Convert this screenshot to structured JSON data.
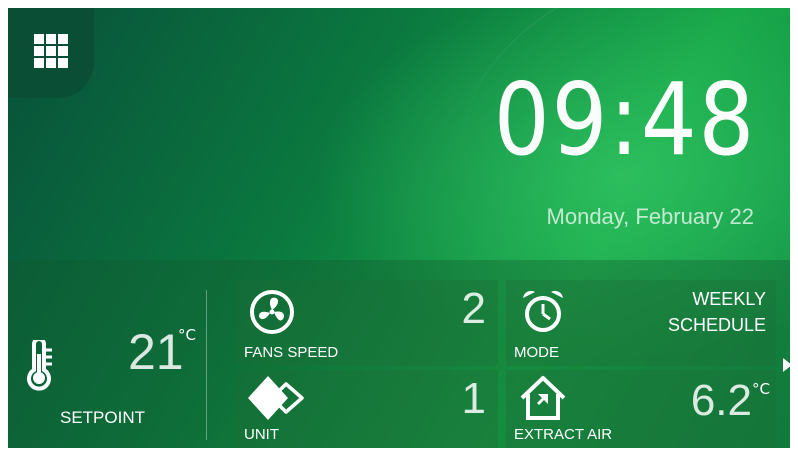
{
  "menu": {
    "icon": "grid-menu-icon"
  },
  "clock": {
    "time": "09:48",
    "date": "Monday, February 22"
  },
  "setpoint": {
    "value": "21",
    "unit": "°C",
    "label": "SETPOINT",
    "icon": "thermometer-icon"
  },
  "tiles": {
    "fans_speed": {
      "label": "FANS SPEED",
      "value": "2",
      "icon": "fan-icon"
    },
    "mode": {
      "label": "MODE",
      "value": "WEEKLY SCHEDULE",
      "value_line1": "WEEKLY",
      "value_line2": "SCHEDULE",
      "icon": "alarm-clock-icon"
    },
    "unit": {
      "label": "UNIT",
      "value": "1",
      "icon": "unit-diamonds-icon"
    },
    "extract_air": {
      "label": "EXTRACT AIR",
      "value": "6.2",
      "unit": "°C",
      "icon": "house-extract-icon"
    }
  },
  "nav": {
    "next_icon": "next-arrow-icon"
  },
  "colors": {
    "bg_dark": "#08503a",
    "bg_light": "#19a84a",
    "text": "#ffffff"
  }
}
